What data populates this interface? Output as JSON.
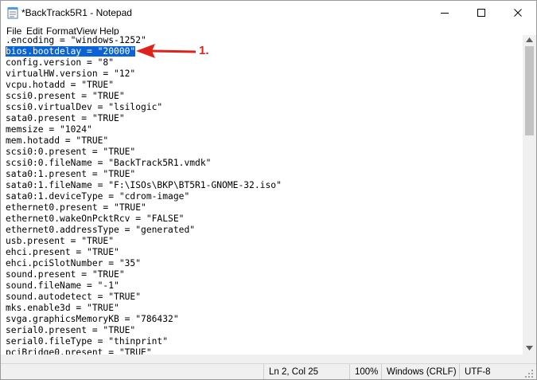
{
  "window": {
    "title": "*BackTrack5R1 - Notepad",
    "controls": {
      "minimize": "—",
      "maximize": "☐",
      "close": "✕"
    }
  },
  "menu": {
    "items": [
      {
        "label": "File"
      },
      {
        "label": "Edit"
      },
      {
        "label": "Format"
      },
      {
        "label": "View"
      },
      {
        "label": "Help"
      }
    ]
  },
  "editor": {
    "selected_line_index": 1,
    "lines": [
      ".encoding = \"windows-1252\"",
      "bios.bootdelay = \"20000\"",
      "config.version = \"8\"",
      "virtualHW.version = \"12\"",
      "vcpu.hotadd = \"TRUE\"",
      "scsi0.present = \"TRUE\"",
      "scsi0.virtualDev = \"lsilogic\"",
      "sata0.present = \"TRUE\"",
      "memsize = \"1024\"",
      "mem.hotadd = \"TRUE\"",
      "scsi0:0.present = \"TRUE\"",
      "scsi0:0.fileName = \"BackTrack5R1.vmdk\"",
      "sata0:1.present = \"TRUE\"",
      "sata0:1.fileName = \"F:\\ISOs\\BKP\\BT5R1-GNOME-32.iso\"",
      "sata0:1.deviceType = \"cdrom-image\"",
      "ethernet0.present = \"TRUE\"",
      "ethernet0.wakeOnPcktRcv = \"FALSE\"",
      "ethernet0.addressType = \"generated\"",
      "usb.present = \"TRUE\"",
      "ehci.present = \"TRUE\"",
      "ehci.pciSlotNumber = \"35\"",
      "sound.present = \"TRUE\"",
      "sound.fileName = \"-1\"",
      "sound.autodetect = \"TRUE\"",
      "mks.enable3d = \"TRUE\"",
      "svga.graphicsMemoryKB = \"786432\"",
      "serial0.present = \"TRUE\"",
      "serial0.fileType = \"thinprint\"",
      "pciBridge0.present = \"TRUE\""
    ]
  },
  "annotation": {
    "label": "1.",
    "color": "#e0221c"
  },
  "status": {
    "position": "Ln 2, Col 25",
    "zoom": "100%",
    "line_ending": "Windows (CRLF)",
    "encoding": "UTF-8"
  },
  "colors": {
    "selection": "#0a64d8",
    "statusbar": "#f0f0f0"
  }
}
